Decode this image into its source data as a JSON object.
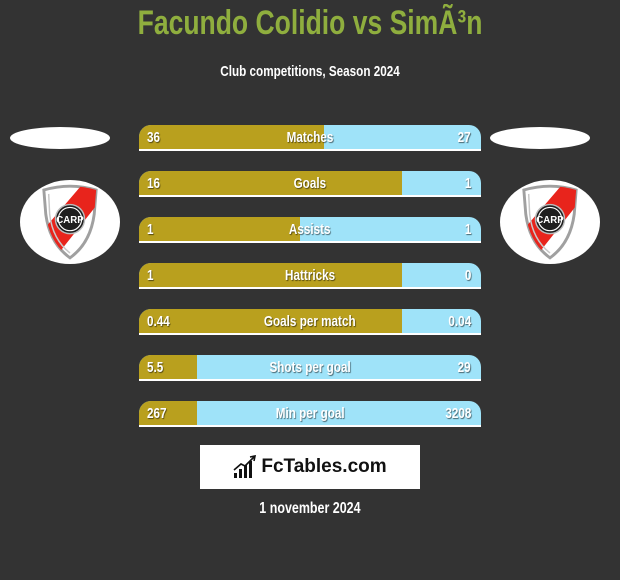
{
  "title": "Facundo Colidio vs SimÃ³n",
  "subtitle": "Club competitions, Season 2024",
  "colors": {
    "background": "#333333",
    "title": "#8fae3e",
    "left_player": "#b9a01e",
    "right_player": "#9fe3f9"
  },
  "teams": {
    "left": {
      "logo": "river-plate-crest-icon",
      "crest_text": "CARP"
    },
    "right": {
      "logo": "river-plate-crest-icon",
      "crest_text": "CARP"
    }
  },
  "rows": [
    {
      "label": "Matches",
      "left": "36",
      "right": "27",
      "left_fill": 0.54
    },
    {
      "label": "Goals",
      "left": "16",
      "right": "1",
      "left_fill": 0.77
    },
    {
      "label": "Assists",
      "left": "1",
      "right": "1",
      "left_fill": 0.47
    },
    {
      "label": "Hattricks",
      "left": "1",
      "right": "0",
      "left_fill": 0.77
    },
    {
      "label": "Goals per match",
      "left": "0.44",
      "right": "0.04",
      "left_fill": 0.77
    },
    {
      "label": "Shots per goal",
      "left": "5.5",
      "right": "29",
      "left_fill": 0.17
    },
    {
      "label": "Min per goal",
      "left": "267",
      "right": "3208",
      "left_fill": 0.17
    }
  ],
  "brand": {
    "name": "FcTables.com",
    "icon": "bar-chart-icon"
  },
  "date": "1 november 2024"
}
